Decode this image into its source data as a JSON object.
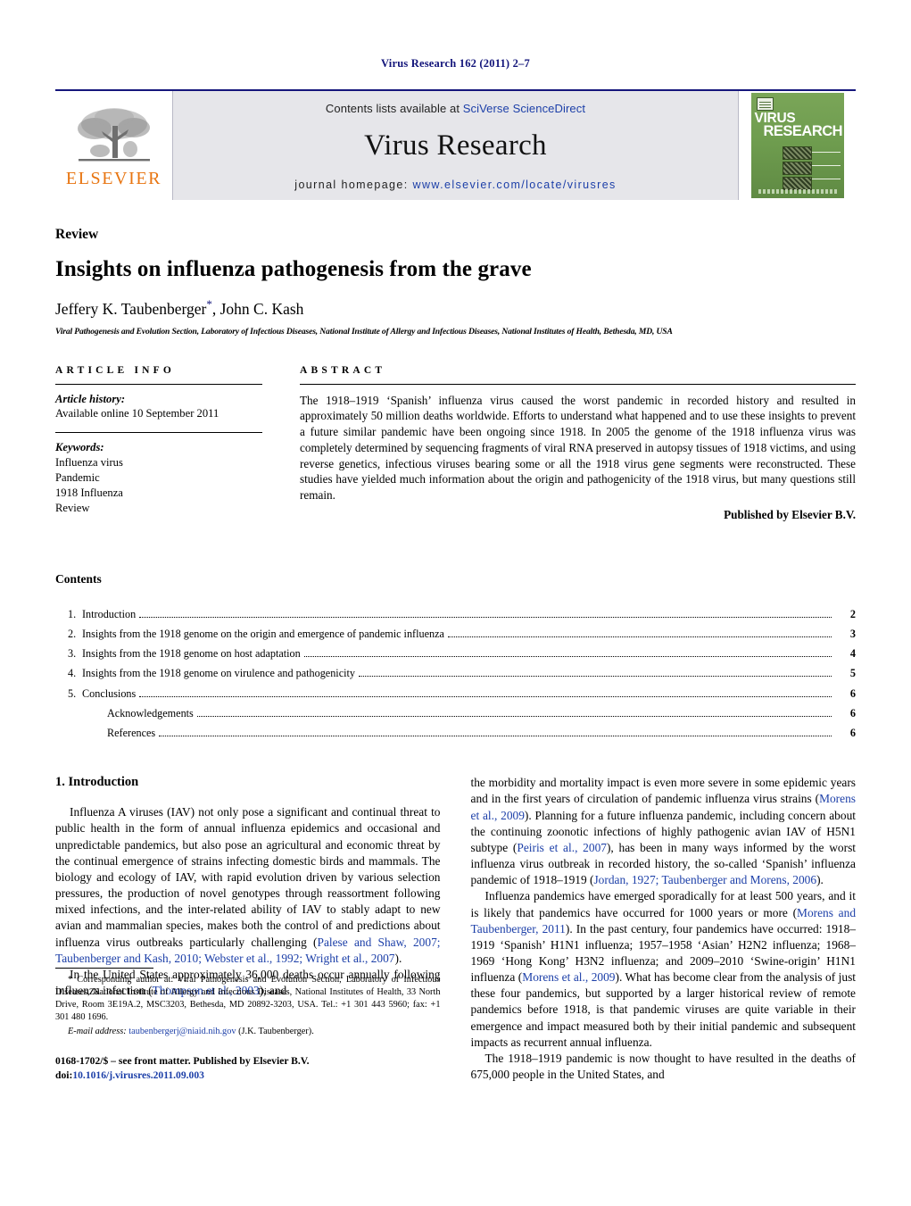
{
  "running_head": "Virus Research 162 (2011) 2–7",
  "masthead": {
    "publisher_logo_name": "ELSEVIER",
    "contents_prefix": "Contents lists available at ",
    "contents_link": "SciVerse ScienceDirect",
    "journal_name": "Virus Research",
    "homepage_prefix": "journal homepage: ",
    "homepage_link": "www.elsevier.com/locate/virusres",
    "cover": {
      "line1": "VIRUS",
      "line2": "RESEARCH"
    }
  },
  "article": {
    "type": "Review",
    "title": "Insights on influenza pathogenesis from the grave",
    "authors": "Jeffery K. Taubenberger",
    "author_marker": "*",
    "authors_rest": ", John C. Kash",
    "affiliation": "Viral Pathogenesis and Evolution Section, Laboratory of Infectious Diseases, National Institute of Allergy and Infectious Diseases, National Institutes of Health, Bethesda, MD, USA"
  },
  "article_info": {
    "label": "ARTICLE INFO",
    "history_label": "Article history:",
    "history_value": "Available online 10 September 2011",
    "keywords_label": "Keywords:",
    "keywords": [
      "Influenza virus",
      "Pandemic",
      "1918 Influenza",
      "Review"
    ]
  },
  "abstract": {
    "label": "ABSTRACT",
    "text": "The 1918–1919 ‘Spanish’ influenza virus caused the worst pandemic in recorded history and resulted in approximately 50 million deaths worldwide. Efforts to understand what happened and to use these insights to prevent a future similar pandemic have been ongoing since 1918. In 2005 the genome of the 1918 influenza virus was completely determined by sequencing fragments of viral RNA preserved in autopsy tissues of 1918 victims, and using reverse genetics, infectious viruses bearing some or all the 1918 virus gene segments were reconstructed. These studies have yielded much information about the origin and pathogenicity of the 1918 virus, but many questions still remain.",
    "publisher_note": "Published by Elsevier B.V."
  },
  "contents": {
    "heading": "Contents",
    "entries": [
      {
        "num": "1.",
        "label": "Introduction",
        "page": "2",
        "indent": false
      },
      {
        "num": "2.",
        "label": "Insights from the 1918 genome on the origin and emergence of pandemic influenza",
        "page": "3",
        "indent": false
      },
      {
        "num": "3.",
        "label": "Insights from the 1918 genome on host adaptation",
        "page": "4",
        "indent": false
      },
      {
        "num": "4.",
        "label": "Insights from the 1918 genome on virulence and pathogenicity",
        "page": "5",
        "indent": false
      },
      {
        "num": "5.",
        "label": "Conclusions",
        "page": "6",
        "indent": false
      },
      {
        "num": "",
        "label": "Acknowledgements",
        "page": "6",
        "indent": true
      },
      {
        "num": "",
        "label": "References",
        "page": "6",
        "indent": true
      }
    ]
  },
  "body": {
    "section_heading": "1. Introduction",
    "left_para1_a": "Influenza A viruses (IAV) not only pose a significant and continual threat to public health in the form of annual influenza epidemics and occasional and unpredictable pandemics, but also pose an agricultural and economic threat by the continual emergence of strains infecting domestic birds and mammals. The biology and ecology of IAV, with rapid evolution driven by various selection pressures, the production of novel genotypes through reassortment following mixed infections, and the inter-related ability of IAV to stably adapt to new avian and mammalian species, makes both the control of and predictions about influenza virus outbreaks particularly challenging (",
    "left_para1_cite": "Palese and Shaw, 2007; Taubenberger and Kash, 2010; Webster et al., 1992; Wright et al., 2007",
    "left_para1_b": ").",
    "left_para2_a": "In the United States approximately 36,000 deaths occur annually following influenza infection (",
    "left_para2_cite": "Thompson et al., 2003",
    "left_para2_b": "), and",
    "right_para1_a": "the morbidity and mortality impact is even more severe in some epidemic years and in the first years of circulation of pandemic influenza virus strains (",
    "right_para1_cite1": "Morens et al., 2009",
    "right_para1_b": "). Planning for a future influenza pandemic, including concern about the continuing zoonotic infections of highly pathogenic avian IAV of H5N1 subtype (",
    "right_para1_cite2": "Peiris et al., 2007",
    "right_para1_c": "), has been in many ways informed by the worst influenza virus outbreak in recorded history, the so-called ‘Spanish’ influenza pandemic of 1918–1919 (",
    "right_para1_cite3": "Jordan, 1927; Taubenberger and Morens, 2006",
    "right_para1_d": ").",
    "right_para2_a": "Influenza pandemics have emerged sporadically for at least 500 years, and it is likely that pandemics have occurred for 1000 years or more (",
    "right_para2_cite1": "Morens and Taubenberger, 2011",
    "right_para2_b": "). In the past century, four pandemics have occurred: 1918–1919 ‘Spanish’ H1N1 influenza; 1957–1958 ‘Asian’ H2N2 influenza; 1968–1969 ‘Hong Kong’ H3N2 influenza; and 2009–2010 ‘Swine-origin’ H1N1 influenza (",
    "right_para2_cite2": "Morens et al., 2009",
    "right_para2_c": "). What has become clear from the analysis of just these four pandemics, but supported by a larger historical review of remote pandemics before 1918, is that pandemic viruses are quite variable in their emergence and impact measured both by their initial pandemic and subsequent impacts as recurrent annual influenza.",
    "right_para3": "The 1918–1919 pandemic is now thought to have resulted in the deaths of 675,000 people in the United States, and"
  },
  "footnotes": {
    "corresponding_marker": "*",
    "corresponding_text": "Corresponding author at: Viral Pathogenesis and Evolution Section, Laboratory of Infectious Diseases, National Institute of Allergy and Infectious Diseases, National Institutes of Health, 33 North Drive, Room 3E19A.2, MSC3203, Bethesda, MD 20892-3203, USA. Tel.: +1 301 443 5960; fax: +1 301 480 1696.",
    "email_label": "E-mail address:",
    "email": "taubenbergerj@niaid.nih.gov",
    "email_suffix": "(J.K. Taubenberger).",
    "issn_line": "0168-1702/$ – see front matter. Published by Elsevier B.V.",
    "doi_label": "doi:",
    "doi_value": "10.1016/j.virusres.2011.09.003"
  }
}
